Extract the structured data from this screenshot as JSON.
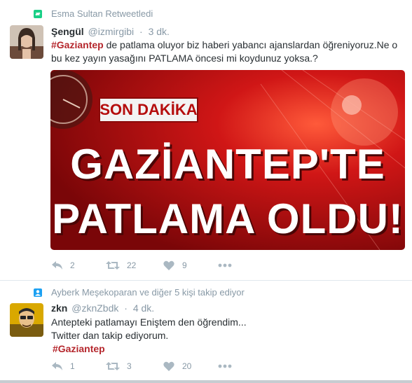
{
  "tweets": [
    {
      "context": "Esma Sultan Retweetledi",
      "name": "Şengül",
      "screen_name": "@izmirgibi",
      "time": "3 dk.",
      "hashtag": "#Gaziantep",
      "text_after_tag": " de patlama oluyor biz haberi yabancı ajanslardan öğreniyoruz.Ne o",
      "text_line2": "bu kez yayın yasağını PATLAMA öncesi mi koydunuz yoksa.?",
      "media": {
        "banner": "SON DAKİKA",
        "headline1": "GAZİANTEP'TE",
        "headline2": "PATLAMA OLDU!"
      },
      "actions": {
        "reply": "2",
        "retweet": "22",
        "like": "9"
      }
    },
    {
      "context": "Ayberk Meşekoparan ve diğer 5 kişi takip ediyor",
      "name": "zkn",
      "screen_name": "@zknZbdk",
      "time": "4 dk.",
      "line1": "Antepteki patlamayı Eniştem den öğrendim...",
      "line2": "Twitter dan takip ediyorum.",
      "hashtag": "#Gaziantep",
      "actions": {
        "reply": "1",
        "retweet": "3",
        "like": "20"
      }
    }
  ],
  "colors": {
    "hashtag": "#b5272d",
    "retweet_icon": "#19cf86",
    "follow_icon": "#1da1f2",
    "muted": "#8899a6"
  }
}
